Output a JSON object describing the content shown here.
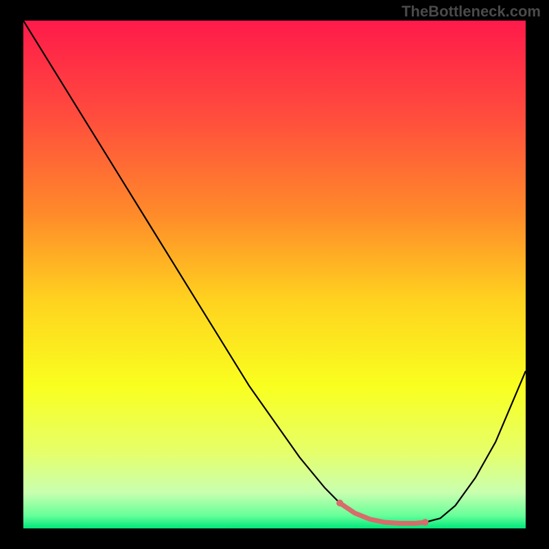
{
  "watermark": "TheBottleneck.com",
  "chart_data": {
    "type": "line",
    "title": "",
    "xlabel": "",
    "ylabel": "",
    "xlim": [
      0,
      100
    ],
    "ylim": [
      0,
      100
    ],
    "gradient_stops": [
      {
        "offset": 0,
        "color": "#ff1a4a"
      },
      {
        "offset": 0.18,
        "color": "#ff4a3e"
      },
      {
        "offset": 0.38,
        "color": "#ff8a2a"
      },
      {
        "offset": 0.55,
        "color": "#ffd21f"
      },
      {
        "offset": 0.72,
        "color": "#f9ff1f"
      },
      {
        "offset": 0.85,
        "color": "#e6ff6a"
      },
      {
        "offset": 0.93,
        "color": "#c8ffb0"
      },
      {
        "offset": 0.975,
        "color": "#66ff99"
      },
      {
        "offset": 1.0,
        "color": "#00e67a"
      }
    ],
    "curve": {
      "x": [
        0,
        5,
        10,
        15,
        20,
        25,
        30,
        35,
        40,
        45,
        50,
        55,
        60,
        63,
        66,
        69,
        72,
        75,
        78,
        80,
        83,
        86,
        90,
        94,
        97,
        100
      ],
      "y": [
        100,
        92,
        84,
        76,
        68,
        60,
        52,
        44,
        36,
        28,
        21,
        14,
        8,
        5,
        3,
        1.8,
        1.2,
        1.0,
        1.0,
        1.2,
        2.0,
        4.5,
        10,
        17,
        24,
        31
      ]
    },
    "highlight_band": {
      "x": [
        63,
        66,
        69,
        72,
        75,
        78,
        80
      ],
      "y": [
        5,
        3,
        1.8,
        1.2,
        1.0,
        1.0,
        1.2
      ],
      "color": "#d86b6b",
      "endpoint_radius": 5,
      "stroke_width": 7
    },
    "curve_stroke": "#000000",
    "curve_stroke_width": 2.2
  }
}
